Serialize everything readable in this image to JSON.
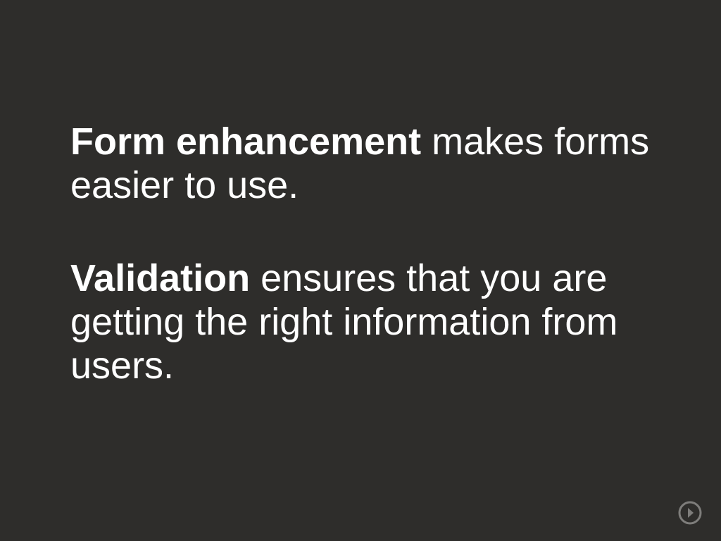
{
  "slide": {
    "paragraphs": [
      {
        "bold": "Form enhancement",
        "rest": " makes forms easier to use."
      },
      {
        "bold": "Validation",
        "rest": " ensures that you are getting the right information from users."
      }
    ]
  },
  "nav": {
    "next_icon": "arrow-right-circle-icon"
  },
  "colors": {
    "background": "#2e2d2b",
    "text": "#ffffff",
    "icon": "#7e7d7b"
  }
}
